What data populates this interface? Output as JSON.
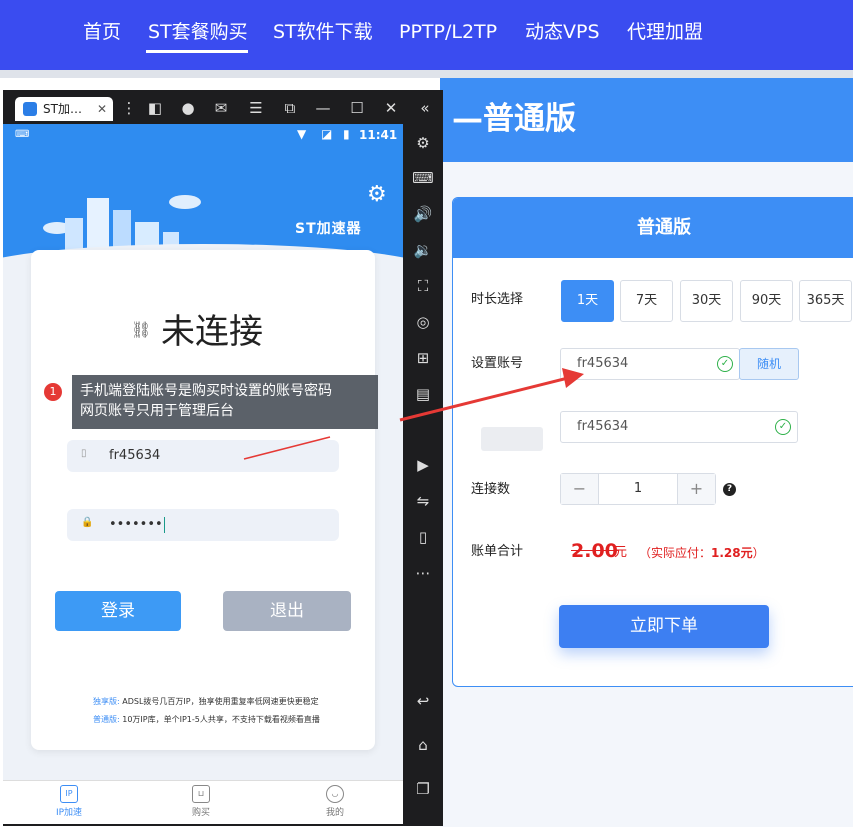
{
  "nav": {
    "items": [
      "首页",
      "ST套餐购买",
      "ST软件下载",
      "PPTP/L2TP",
      "动态VPS",
      "代理加盟"
    ],
    "active_index": 1
  },
  "hero": {
    "title": "—普通版"
  },
  "card": {
    "title": "普通版",
    "duration_label": "时长选择",
    "durations": [
      "1天",
      "7天",
      "30天",
      "90天",
      "365天"
    ],
    "selected_duration": "1天",
    "account_label": "设置账号",
    "account_value": "fr45634",
    "random_button": "随机",
    "password_value": "fr45634",
    "connections_label": "连接数",
    "connections_value": "1",
    "total_label": "账单合计",
    "original_price": "2.00",
    "currency": "元",
    "paid_prefix": "（实际应付：",
    "paid_amount": "1.28元",
    "paid_suffix": "）",
    "order_button": "立即下单"
  },
  "emulator": {
    "tab_title": "ST加…",
    "status_time": "11:41",
    "app_name": "ST加速器",
    "connection_status": "未连接",
    "username": "fr45634",
    "password_mask": "•••••••",
    "login_button": "登录",
    "logout_button": "退出",
    "note1_label": "独享版:",
    "note1_text": "ADSL拨号几百万IP，独享使用重复率低网速更快更稳定",
    "note2_label": "普通版:",
    "note2_text": "10万IP库，单个IP1-5人共享，不支持下载看视频看直播",
    "bottom_nav": [
      "IP加速",
      "购买",
      "我的"
    ]
  },
  "tooltip": {
    "badge": "1",
    "line1": "手机端登陆账号是购买时设置的账号密码",
    "line2": "网页账号只用于管理后台"
  },
  "colors": {
    "nav_bg": "#3a4cf0",
    "accent": "#3d8ef5",
    "price_red": "#e02020",
    "emulator_bg": "#1d1d1f"
  }
}
